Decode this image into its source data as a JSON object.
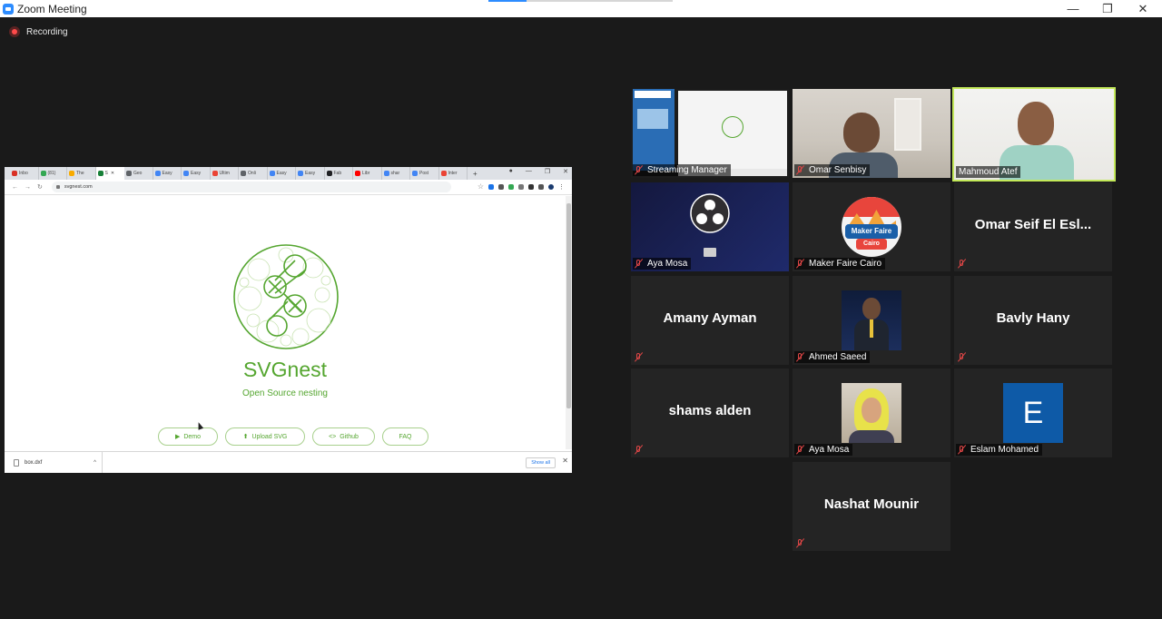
{
  "window": {
    "title": "Zoom Meeting",
    "minimize": "—",
    "restore": "❐",
    "close": "✕"
  },
  "recording": {
    "label": "Recording"
  },
  "shared_screen": {
    "tabs": [
      "Inbo",
      "(81)",
      "The",
      "S",
      "Geo",
      "Easy",
      "Easy",
      "Ultim",
      "Onli",
      "Easy",
      "Easy",
      "Fab",
      "Libr",
      "shar",
      "Post",
      "Inter"
    ],
    "tab_colors": [
      "#d93025",
      "#34a853",
      "#f9ab00",
      "#188038",
      "#5f6368",
      "#4285f4",
      "#4285f4",
      "#ea4335",
      "#5f6368",
      "#4285f4",
      "#4285f4",
      "#202124",
      "#ff0000",
      "#4285f4",
      "#4285f4",
      "#ea4335"
    ],
    "new_tab": "+",
    "url": "svgnest.com",
    "page": {
      "brand": "SVGnest",
      "tagline": "Open Source nesting",
      "buttons": [
        {
          "icon": "▶",
          "label": "Demo"
        },
        {
          "icon": "⬆",
          "label": "Upload SVG"
        },
        {
          "icon": "<>",
          "label": "Github"
        },
        {
          "icon": "",
          "label": "FAQ"
        }
      ]
    },
    "download": {
      "file": "box.dxf",
      "show_all": "Show all"
    }
  },
  "participants": [
    {
      "name": "Streaming Manager",
      "muted": true,
      "view": "screen"
    },
    {
      "name": "Omar Senbisy",
      "muted": true,
      "view": "video"
    },
    {
      "name": "Mahmoud Atef",
      "muted": false,
      "view": "video",
      "speaking": true
    },
    {
      "name": "Aya Mosa",
      "muted": true,
      "view": "obs-camera-off"
    },
    {
      "name": "Maker Faire Cairo",
      "muted": true,
      "view": "logo"
    },
    {
      "name": "Omar Seif El Esl...",
      "muted": true,
      "view": "name-only",
      "label_shown": false
    },
    {
      "name": "Amany Ayman",
      "muted": true,
      "view": "name-only",
      "label_shown": false
    },
    {
      "name": "Ahmed Saeed",
      "muted": true,
      "view": "photo"
    },
    {
      "name": "Bavly Hany",
      "muted": true,
      "view": "name-only",
      "label_shown": false
    },
    {
      "name": "shams alden",
      "muted": true,
      "view": "name-only",
      "label_shown": false
    },
    {
      "name": "Aya Mosa",
      "muted": true,
      "view": "photo"
    },
    {
      "name": "Eslam Mohamed",
      "muted": true,
      "view": "avatar",
      "initial": "E"
    },
    {
      "name": "Nashat Mounir",
      "muted": true,
      "view": "name-only",
      "label_shown": false
    }
  ],
  "mfc_badge": {
    "line1": "Maker Faire",
    "line2": "Cairo"
  },
  "colors": {
    "speaking_border": "#c3e85a",
    "accent_green": "#55a630",
    "zoom_blue": "#2d8cff",
    "mute_red": "#e04646"
  }
}
